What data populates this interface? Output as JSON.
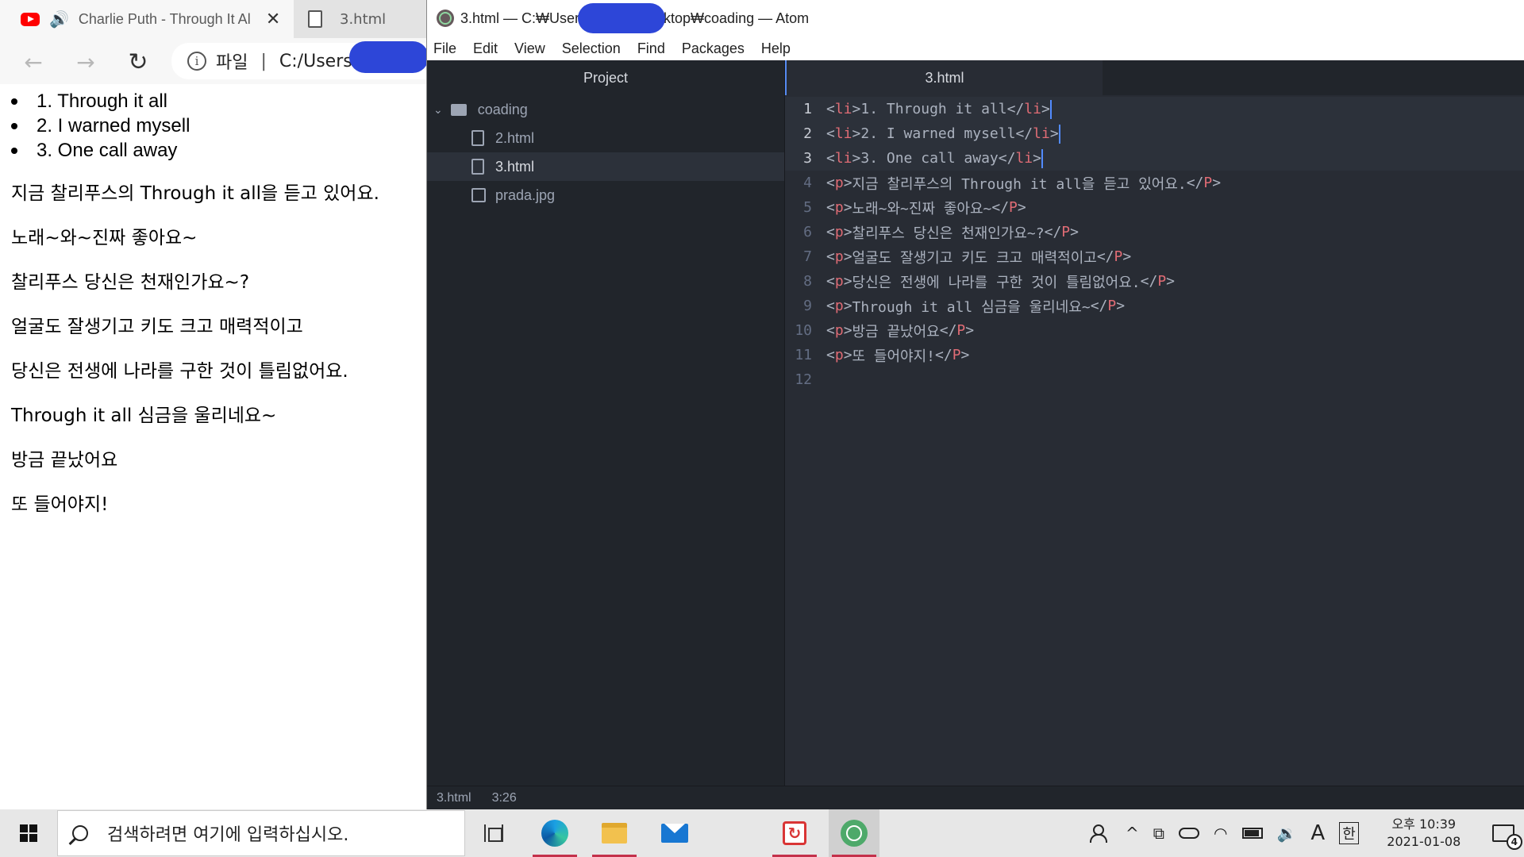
{
  "browser": {
    "tabs": [
      {
        "title": "Charlie Puth - Through It Al",
        "close": "✕",
        "audio": "speaker-icon"
      },
      {
        "title": "3.html"
      }
    ],
    "nav": {
      "back": "←",
      "forward": "→",
      "reload": "↻"
    },
    "address": {
      "info": "i",
      "scheme": "파일",
      "separator": "|",
      "path": "C:/Users"
    },
    "content": {
      "list": [
        "1. Through it all",
        "2. I warned mysell",
        "3. One call away"
      ],
      "paragraphs": [
        "지금 찰리푸스의 Through it all을 듣고 있어요.",
        "노래~와~진짜 좋아요~",
        "찰리푸스 당신은 천재인가요~?",
        "얼굴도 잘생기고 키도 크고 매력적이고",
        "당신은 전생에 나라를 구한 것이 틀림없어요.",
        "Through it all 심금을 울리네요~",
        "방금 끝났어요",
        "또 들어야지!"
      ]
    }
  },
  "atom": {
    "title_left": "3.html — C:₩Users",
    "title_right": "esktop₩coading — Atom",
    "menu": [
      "File",
      "Edit",
      "View",
      "Selection",
      "Find",
      "Packages",
      "Help"
    ],
    "project_header": "Project",
    "tree": {
      "folder": "coading",
      "files": [
        "2.html",
        "3.html",
        "prada.jpg"
      ],
      "selected": "3.html"
    },
    "tab": "3.html",
    "code": [
      {
        "ln": "1",
        "o": "<",
        "t": "li",
        "c": ">",
        "text": "1. Through it all",
        "eo": "</",
        "et": "li",
        "ec": ">"
      },
      {
        "ln": "2",
        "o": "<",
        "t": "li",
        "c": ">",
        "text": "2. I warned mysell",
        "eo": "</",
        "et": "li",
        "ec": ">"
      },
      {
        "ln": "3",
        "o": "<",
        "t": "li",
        "c": ">",
        "text": "3. One call away",
        "eo": "</",
        "et": "li",
        "ec": ">"
      },
      {
        "ln": "4",
        "o": "<",
        "t": "p",
        "c": ">",
        "text": "지금 찰리푸스의 Through it all을 듣고 있어요.",
        "eo": "</",
        "et": "P",
        "ec": ">"
      },
      {
        "ln": "5",
        "o": "<",
        "t": "p",
        "c": ">",
        "text": "노래~와~진짜 좋아요~",
        "eo": "</",
        "et": "P",
        "ec": ">"
      },
      {
        "ln": "6",
        "o": "<",
        "t": "p",
        "c": ">",
        "text": "찰리푸스 당신은 천재인가요~?",
        "eo": "</",
        "et": "P",
        "ec": ">"
      },
      {
        "ln": "7",
        "o": "<",
        "t": "p",
        "c": ">",
        "text": "얼굴도 잘생기고 키도 크고 매력적이고",
        "eo": "</",
        "et": "P",
        "ec": ">"
      },
      {
        "ln": "8",
        "o": "<",
        "t": "p",
        "c": ">",
        "text": "당신은 전생에 나라를 구한 것이 틀림없어요.",
        "eo": "</",
        "et": "P",
        "ec": ">"
      },
      {
        "ln": "9",
        "o": "<",
        "t": "p",
        "c": ">",
        "text": "Through it all 심금을 울리네요~",
        "eo": "</",
        "et": "P",
        "ec": ">"
      },
      {
        "ln": "10",
        "o": "<",
        "t": "p",
        "c": ">",
        "text": "방금 끝났어요",
        "eo": "</",
        "et": "P",
        "ec": ">"
      },
      {
        "ln": "11",
        "o": "<",
        "t": "p",
        "c": ">",
        "text": "또 들어야지!",
        "eo": "</",
        "et": "P",
        "ec": ">"
      },
      {
        "ln": "12",
        "o": "",
        "t": "",
        "c": "",
        "text": "",
        "eo": "",
        "et": "",
        "ec": ""
      }
    ],
    "status": {
      "file": "3.html",
      "cursor": "3:26"
    }
  },
  "taskbar": {
    "search_placeholder": "검색하려면 여기에 입력하십시오.",
    "tray": {
      "input_lang": "A",
      "ime": "한",
      "time": "오후 10:39",
      "date": "2021-01-08",
      "notifications": "4"
    }
  },
  "colors": {
    "redaction": "#2d46d8",
    "atom_bg": "#282c34",
    "tag": "#e06c75",
    "text": "#abb2bf"
  }
}
